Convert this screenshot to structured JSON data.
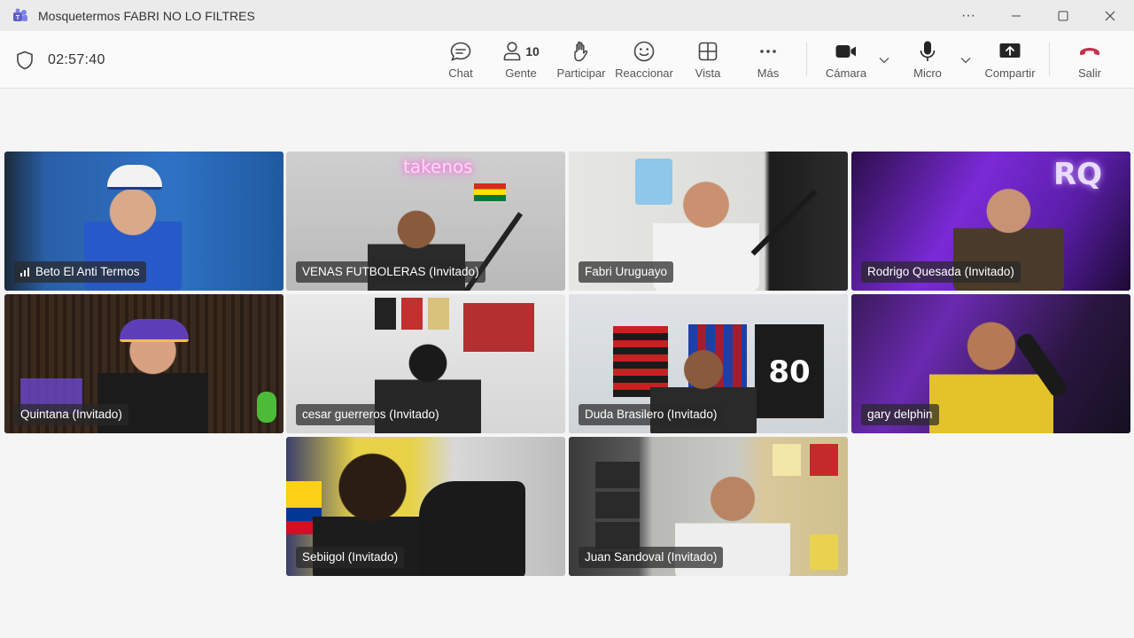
{
  "window": {
    "title": "Mosquetermos FABRI NO LO FILTRES"
  },
  "meeting": {
    "elapsed": "02:57:40"
  },
  "toolbar": {
    "chat_label": "Chat",
    "people_label": "Gente",
    "people_count": "10",
    "raise_label": "Participar",
    "react_label": "Reaccionar",
    "view_label": "Vista",
    "more_label": "Más",
    "camera_label": "Cámara",
    "mic_label": "Micro",
    "share_label": "Compartir",
    "leave_label": "Salir"
  },
  "colors": {
    "accent": "#6b6fd6",
    "leave": "#c4314b"
  },
  "participants": [
    {
      "name": "Beto El Anti Termos",
      "speaking_indicator": true,
      "active": false
    },
    {
      "name": "VENAS FUTBOLERAS (Invitado)",
      "active": false,
      "sign_text": "takenos"
    },
    {
      "name": "Fabri Uruguayo",
      "active": true
    },
    {
      "name": "Rodrigo Quesada (Invitado)",
      "active": true,
      "sign_text": "RQ"
    },
    {
      "name": "Quintana (Invitado)",
      "active": true
    },
    {
      "name": "cesar guerreros (Invitado)",
      "active": false
    },
    {
      "name": "Duda Brasilero (Invitado)",
      "active": true,
      "jersey_number": "80"
    },
    {
      "name": "gary delphin",
      "active": true
    },
    {
      "name": "Sebiigol (Invitado)",
      "active": false
    },
    {
      "name": "Juan Sandoval (Invitado)",
      "active": false
    }
  ]
}
